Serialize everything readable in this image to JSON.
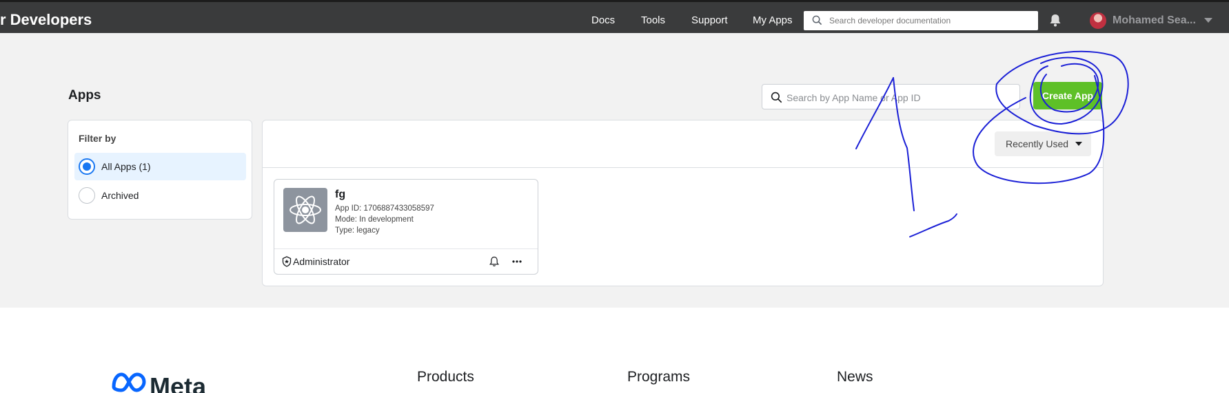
{
  "header": {
    "brand": "r Developers",
    "nav": [
      "Docs",
      "Tools",
      "Support",
      "My Apps"
    ],
    "search_placeholder": "Search developer documentation",
    "user_name": "Mohamed Sea..."
  },
  "page": {
    "title": "Apps",
    "search_placeholder": "Search by App Name or App ID",
    "create_button": "Create App",
    "sort_label": "Recently Used"
  },
  "filter": {
    "title": "Filter by",
    "options": [
      {
        "label": "All Apps (1)",
        "selected": true
      },
      {
        "label": "Archived",
        "selected": false
      }
    ]
  },
  "app": {
    "name": "fg",
    "app_id": "App ID: 1706887433058597",
    "mode": "Mode: In development",
    "type": "Type: legacy",
    "role": "Administrator"
  },
  "footer": {
    "logo_text": "Meta",
    "columns": [
      "Products",
      "Programs",
      "News"
    ]
  },
  "colors": {
    "topbar": "#3a3b3c",
    "accent_green": "#5ec027",
    "primary_blue": "#1877f2",
    "annotation_ink": "#1a1fd6"
  }
}
